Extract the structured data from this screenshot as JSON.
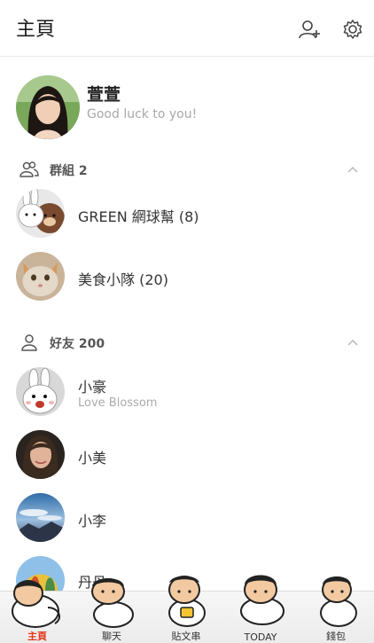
{
  "header": {
    "title": "主頁",
    "add_friend_icon": "add-friend-icon",
    "settings_icon": "gear-icon"
  },
  "profile": {
    "name": "萱萱",
    "status": "Good luck to you!"
  },
  "groups_section": {
    "label": "群組 2",
    "icon": "group-icon"
  },
  "groups": [
    {
      "name": "GREEN 網球幫 (8)"
    },
    {
      "name": "美食小隊 (20)"
    }
  ],
  "friends_section": {
    "label": "好友 200",
    "icon": "person-icon"
  },
  "friends": [
    {
      "name": "小豪",
      "status": "Love Blossom"
    },
    {
      "name": "小美",
      "status": ""
    },
    {
      "name": "小李",
      "status": ""
    },
    {
      "name": "丹丹",
      "status": ""
    }
  ],
  "tabs": [
    {
      "label": "主頁",
      "active": true
    },
    {
      "label": "聊天",
      "active": false
    },
    {
      "label": "貼文串",
      "active": false
    },
    {
      "label": "TODAY",
      "active": false
    },
    {
      "label": "錢包",
      "active": false
    }
  ],
  "colors": {
    "active_tab": "#e4361a",
    "text_secondary": "#aaaaaa"
  }
}
